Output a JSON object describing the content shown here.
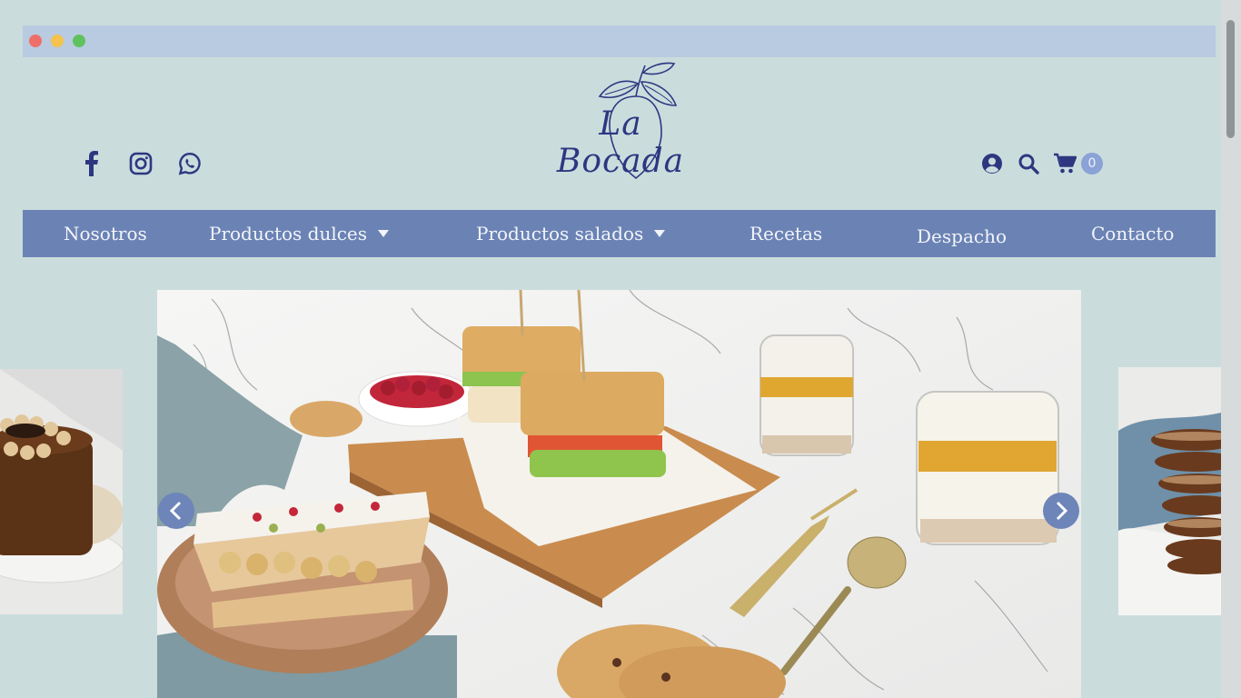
{
  "brand": {
    "name": "La Bocada",
    "color": "#2d3780"
  },
  "social": [
    {
      "name": "facebook-icon"
    },
    {
      "name": "instagram-icon"
    },
    {
      "name": "whatsapp-icon"
    }
  ],
  "header_icons": {
    "account": "user-circle-icon",
    "search": "search-icon",
    "cart": "cart-icon",
    "cart_count": "0"
  },
  "nav": {
    "items": [
      {
        "label": "Nosotros",
        "dropdown": false
      },
      {
        "label": "Productos dulces",
        "dropdown": true
      },
      {
        "label": "Productos salados",
        "dropdown": true
      },
      {
        "label": "Recetas",
        "dropdown": false
      },
      {
        "label": "Despacho",
        "dropdown": false
      },
      {
        "label": "Contacto",
        "dropdown": false
      }
    ],
    "background": "#6b83b4"
  },
  "carousel": {
    "prev_label": "‹",
    "next_label": "›",
    "accent": "#6d85b8"
  }
}
